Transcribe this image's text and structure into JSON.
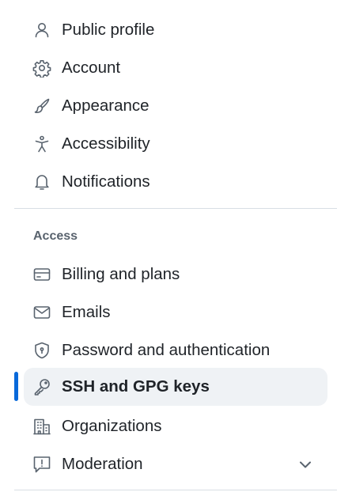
{
  "nav": {
    "top_items": [
      {
        "label": "Public profile",
        "icon": "person-icon"
      },
      {
        "label": "Account",
        "icon": "gear-icon"
      },
      {
        "label": "Appearance",
        "icon": "paintbrush-icon"
      },
      {
        "label": "Accessibility",
        "icon": "accessibility-icon"
      },
      {
        "label": "Notifications",
        "icon": "bell-icon"
      }
    ],
    "access_heading": "Access",
    "access_items": [
      {
        "label": "Billing and plans",
        "icon": "credit-card-icon"
      },
      {
        "label": "Emails",
        "icon": "mail-icon"
      },
      {
        "label": "Password and authentication",
        "icon": "shield-lock-icon"
      },
      {
        "label": "SSH and GPG keys",
        "icon": "key-icon",
        "active": true
      },
      {
        "label": "Organizations",
        "icon": "organization-icon"
      },
      {
        "label": "Moderation",
        "icon": "report-icon",
        "expand_icon": "chevron-down-icon"
      }
    ]
  },
  "colors": {
    "active_indicator": "#0969da",
    "active_background": "#eff2f5",
    "text": "#1f2328",
    "muted": "#59636e"
  }
}
